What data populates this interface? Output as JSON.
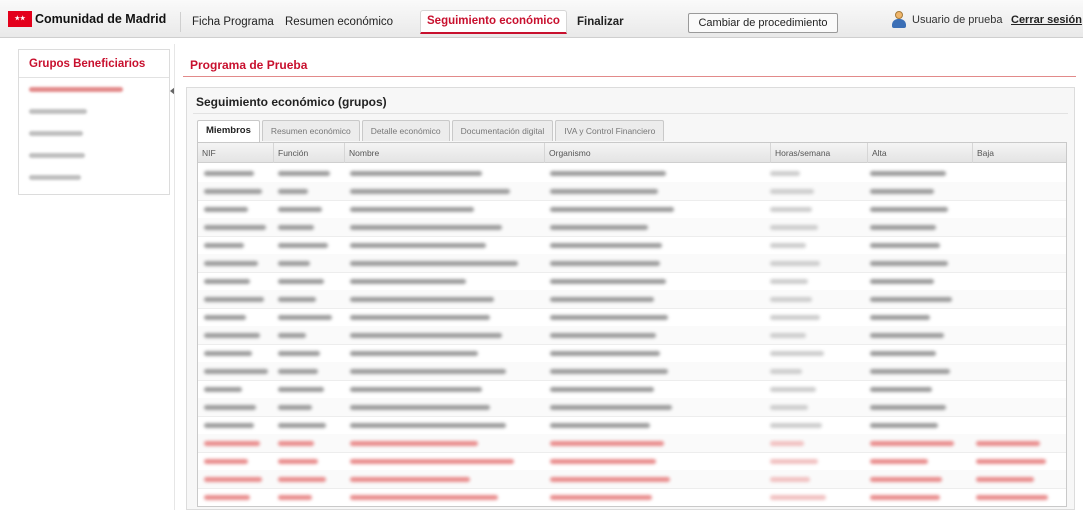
{
  "topbar": {
    "brand": "Comunidad de Madrid",
    "nav": [
      "Ficha Programa",
      "Resumen económico",
      "Seguimiento económico",
      "Finalizar"
    ],
    "active_nav": "Seguimiento económico",
    "change_button": "Cambiar de procedimiento",
    "user": "Usuario de prueba",
    "logout": "Cerrar sesión"
  },
  "sidebar": {
    "title": "Grupos Beneficiarios",
    "items": [
      {
        "style": "red"
      },
      {
        "style": "gray"
      },
      {
        "style": "gray"
      },
      {
        "style": "gray"
      },
      {
        "style": "gray"
      }
    ]
  },
  "main": {
    "program_title": "Programa de Prueba",
    "panel_title": "Seguimiento económico (grupos)",
    "tabs": [
      "Miembros",
      "Resumen económico",
      "Detalle económico",
      "Documentación digital",
      "IVA y Control Financiero"
    ],
    "active_tab": "Miembros",
    "columns": [
      "NIF",
      "Función",
      "Nombre",
      "Organismo",
      "Horas/semana",
      "Alta",
      "Baja"
    ],
    "rows": [
      {
        "style": "normal"
      },
      {
        "style": "normal"
      },
      {
        "style": "normal"
      },
      {
        "style": "normal"
      },
      {
        "style": "normal"
      },
      {
        "style": "normal"
      },
      {
        "style": "normal"
      },
      {
        "style": "normal"
      },
      {
        "style": "normal"
      },
      {
        "style": "normal"
      },
      {
        "style": "normal"
      },
      {
        "style": "normal"
      },
      {
        "style": "normal"
      },
      {
        "style": "normal"
      },
      {
        "style": "normal"
      },
      {
        "style": "red"
      },
      {
        "style": "red"
      },
      {
        "style": "red"
      },
      {
        "style": "red"
      }
    ]
  },
  "colors": {
    "accent": "#c8102e",
    "blur_gray": "#9c9c9c",
    "blur_red": "#e98c8c"
  }
}
